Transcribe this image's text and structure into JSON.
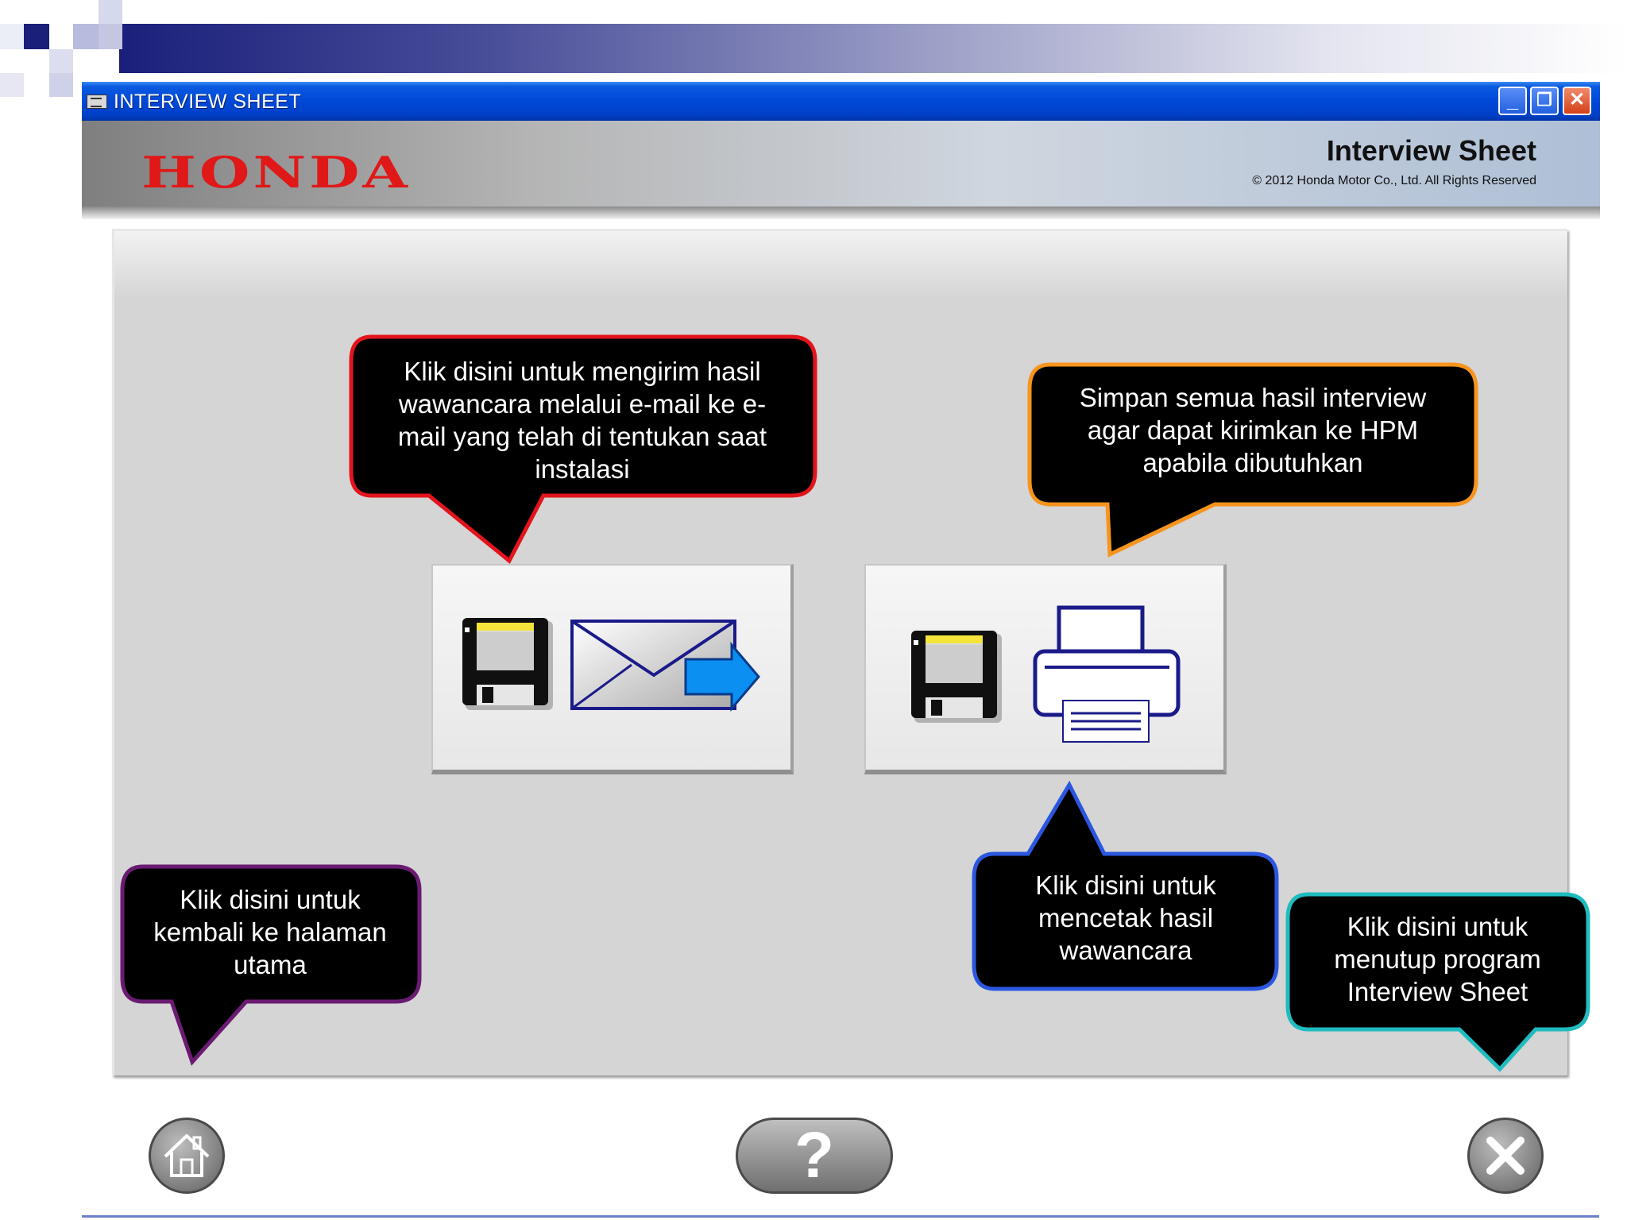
{
  "window": {
    "title": "INTERVIEW SHEET",
    "controls": {
      "minimize": "_",
      "restore": "❐",
      "close": "✕"
    }
  },
  "header": {
    "logo": "HONDA",
    "title": "Interview Sheet",
    "copyright": "© 2012 Honda Motor Co., Ltd. All Rights Reserved"
  },
  "actions": {
    "email_button": {
      "icons": [
        "floppy-disk-icon",
        "email-send-icon"
      ]
    },
    "print_button": {
      "icons": [
        "floppy-disk-icon",
        "printer-icon"
      ]
    }
  },
  "callouts": {
    "email": {
      "text": "Klik disini untuk mengirim hasil wawancara melalui e-mail ke e-mail yang telah di tentukan saat instalasi",
      "color": "#e3141b"
    },
    "save": {
      "text": "Simpan semua hasil interview agar dapat kirimkan ke HPM apabila dibutuhkan",
      "color": "#f7941d"
    },
    "print": {
      "text": "Klik disini untuk mencetak hasil wawancara",
      "color": "#2b57e0"
    },
    "home": {
      "text": "Klik disini untuk kembali ke halaman utama",
      "color": "#6b1b72"
    },
    "close": {
      "text": "Klik disini untuk menutup program Interview Sheet",
      "color": "#1fbcbf"
    }
  },
  "footer": {
    "home_icon": "home-icon",
    "help_label": "?",
    "close_icon": "close-icon"
  },
  "colors": {
    "titlebar": "#0048d8",
    "honda_red": "#e01818",
    "panel_bg": "#d5d5d5"
  }
}
